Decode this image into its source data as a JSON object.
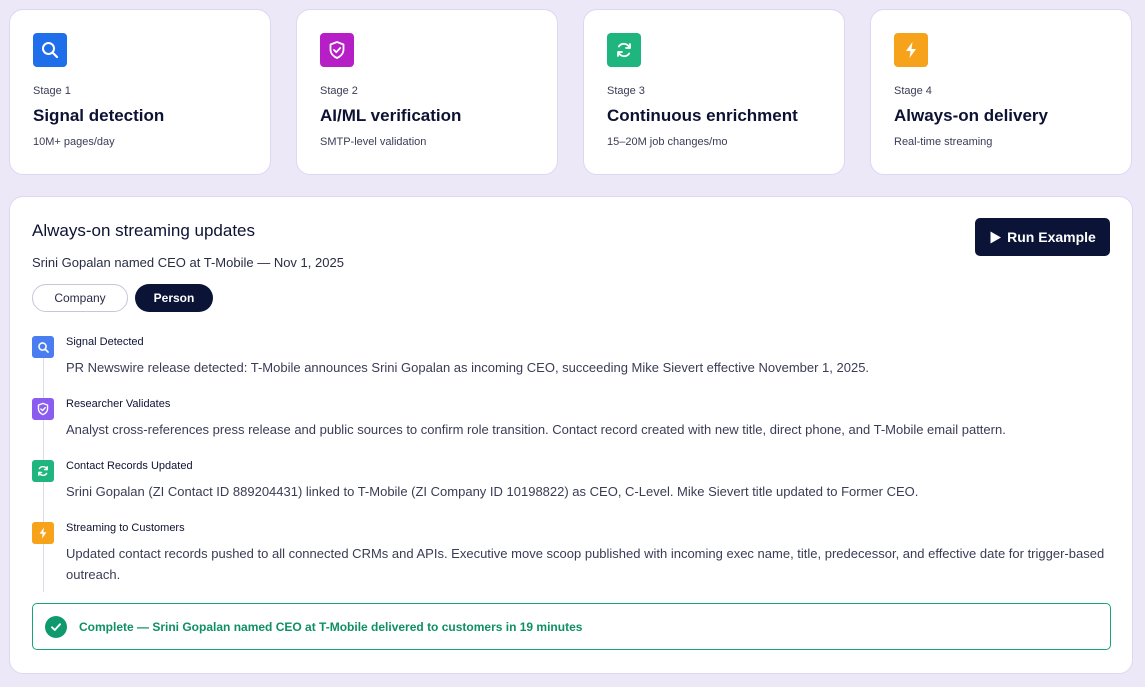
{
  "stages": [
    {
      "num": "Stage 1",
      "title": "Signal detection",
      "sub": "10M+ pages/day",
      "icon": "search-icon",
      "color": "#1f6feb"
    },
    {
      "num": "Stage 2",
      "title": "AI/ML verification",
      "sub": "SMTP-level validation",
      "icon": "shield-check-icon",
      "color": "#b61fc6"
    },
    {
      "num": "Stage 3",
      "title": "Continuous enrichment",
      "sub": "15–20M job changes/mo",
      "icon": "refresh-icon",
      "color": "#1fb57f"
    },
    {
      "num": "Stage 4",
      "title": "Always-on delivery",
      "sub": "Real-time streaming",
      "icon": "lightning-icon",
      "color": "#f7a21b"
    }
  ],
  "panel": {
    "title": "Always-on streaming updates",
    "subtitle": "Srini Gopalan named CEO at T-Mobile — Nov 1, 2025",
    "run_label": "Run Example",
    "toggle": {
      "company": "Company",
      "person": "Person",
      "selected": "Person"
    }
  },
  "steps": [
    {
      "title": "Signal Detected",
      "desc": "PR Newswire release detected: T-Mobile announces Srini Gopalan as incoming CEO, succeeding Mike Sievert effective November 1, 2025.",
      "icon": "search-icon",
      "color": "#4a7df0"
    },
    {
      "title": "Researcher Validates",
      "desc": "Analyst cross-references press release and public sources to confirm role transition. Contact record created with new title, direct phone, and T-Mobile email pattern.",
      "icon": "shield-check-icon",
      "color": "#8b5cf0"
    },
    {
      "title": "Contact Records Updated",
      "desc": "Srini Gopalan (ZI Contact ID 889204431) linked to T-Mobile (ZI Company ID 10198822) as CEO, C-Level. Mike Sievert title updated to Former CEO.",
      "icon": "refresh-icon",
      "color": "#1fb57f"
    },
    {
      "title": "Streaming to Customers",
      "desc": "Updated contact records pushed to all connected CRMs and APIs. Executive move scoop published with incoming exec name, title, predecessor, and effective date for trigger-based outreach.",
      "icon": "lightning-icon",
      "color": "#f7a21b"
    }
  ],
  "complete": {
    "text": "Complete — Srini Gopalan named CEO at T-Mobile delivered to customers in 19 minutes",
    "color": "#0e9a6d"
  }
}
